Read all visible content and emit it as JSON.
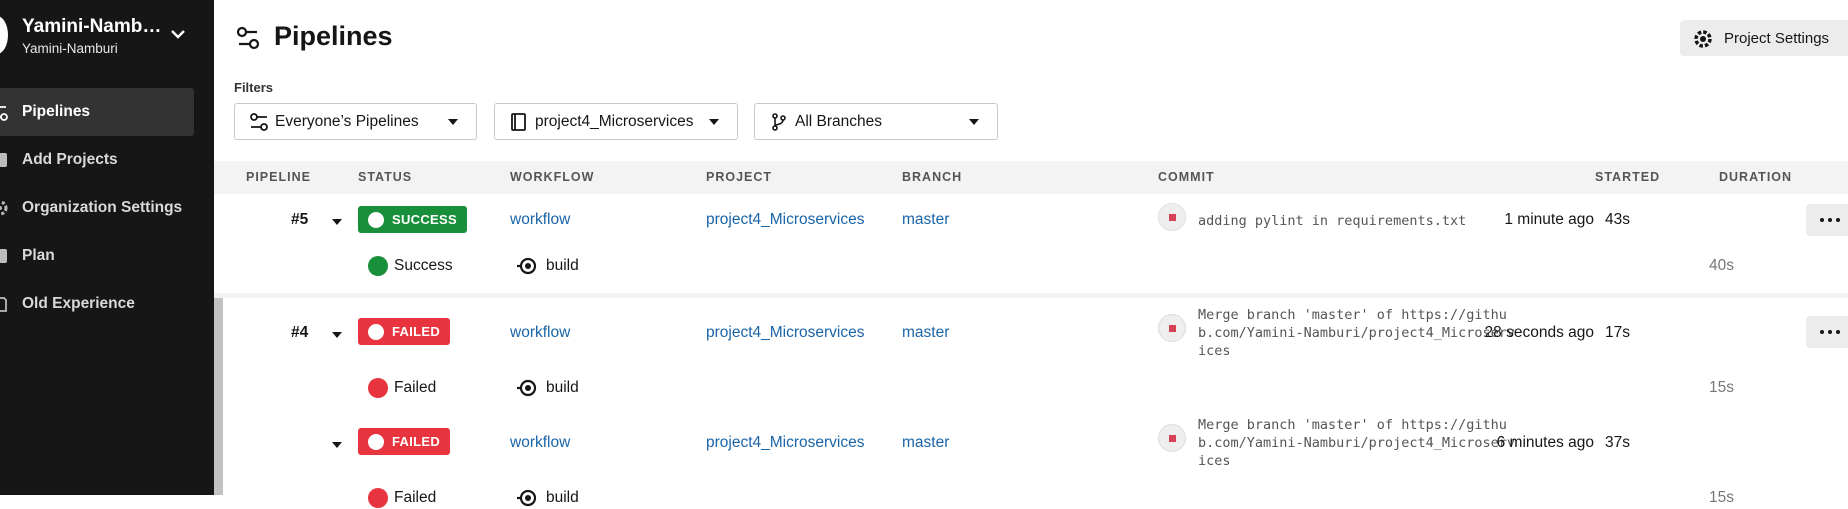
{
  "sidebar": {
    "org_name": "Yamini-Namb…",
    "org_sub": "Yamini-Namburi",
    "items": [
      {
        "label": "Pipelines",
        "icon": "pipelines-icon",
        "active": true
      },
      {
        "label": "Add Projects",
        "icon": "add-projects-icon"
      },
      {
        "label": "Organization Settings",
        "icon": "gear-icon"
      },
      {
        "label": "Plan",
        "icon": "plan-icon"
      },
      {
        "label": "Old Experience",
        "icon": "old-experience-icon"
      }
    ]
  },
  "header": {
    "title": "Pipelines",
    "settings_label": "Project Settings"
  },
  "filters": {
    "label": "Filters",
    "pipelines": "Everyone’s Pipelines",
    "project": "project4_Microservices",
    "branch": "All Branches"
  },
  "table": {
    "headers": {
      "pipeline": "PIPELINE",
      "status": "STATUS",
      "workflow": "WORKFLOW",
      "project": "PROJECT",
      "branch": "BRANCH",
      "commit": "COMMIT",
      "started": "STARTED",
      "duration": "DURATION"
    },
    "rows": [
      {
        "number": "#5",
        "status": "SUCCESS",
        "workflow": "workflow",
        "project": "project4_Microservices",
        "branch": "master",
        "commit": "adding pylint in requirements.txt",
        "started": "1 minute ago",
        "duration": "43s",
        "job": {
          "status": "Success",
          "name": "build",
          "duration": "40s"
        }
      },
      {
        "number": "#4",
        "status": "FAILED",
        "workflow": "workflow",
        "project": "project4_Microservices",
        "branch": "master",
        "commit": "Merge branch 'master' of https://github.com/Yamini-Namburi/project4_Microservices",
        "started": "28 seconds ago",
        "duration": "17s",
        "job": {
          "status": "Failed",
          "name": "build",
          "duration": "15s"
        }
      },
      {
        "number": "",
        "status": "FAILED",
        "workflow": "workflow",
        "project": "project4_Microservices",
        "branch": "master",
        "commit": "Merge branch 'master' of https://github.com/Yamini-Namburi/project4_Microservices",
        "started": "6 minutes ago",
        "duration": "37s",
        "job": {
          "status": "Failed",
          "name": "build",
          "duration": "15s"
        }
      }
    ]
  },
  "colors": {
    "sidebar_bg": "#161616",
    "success": "#1a8f3b",
    "failed": "#e8343e",
    "link": "#1a64a8"
  }
}
